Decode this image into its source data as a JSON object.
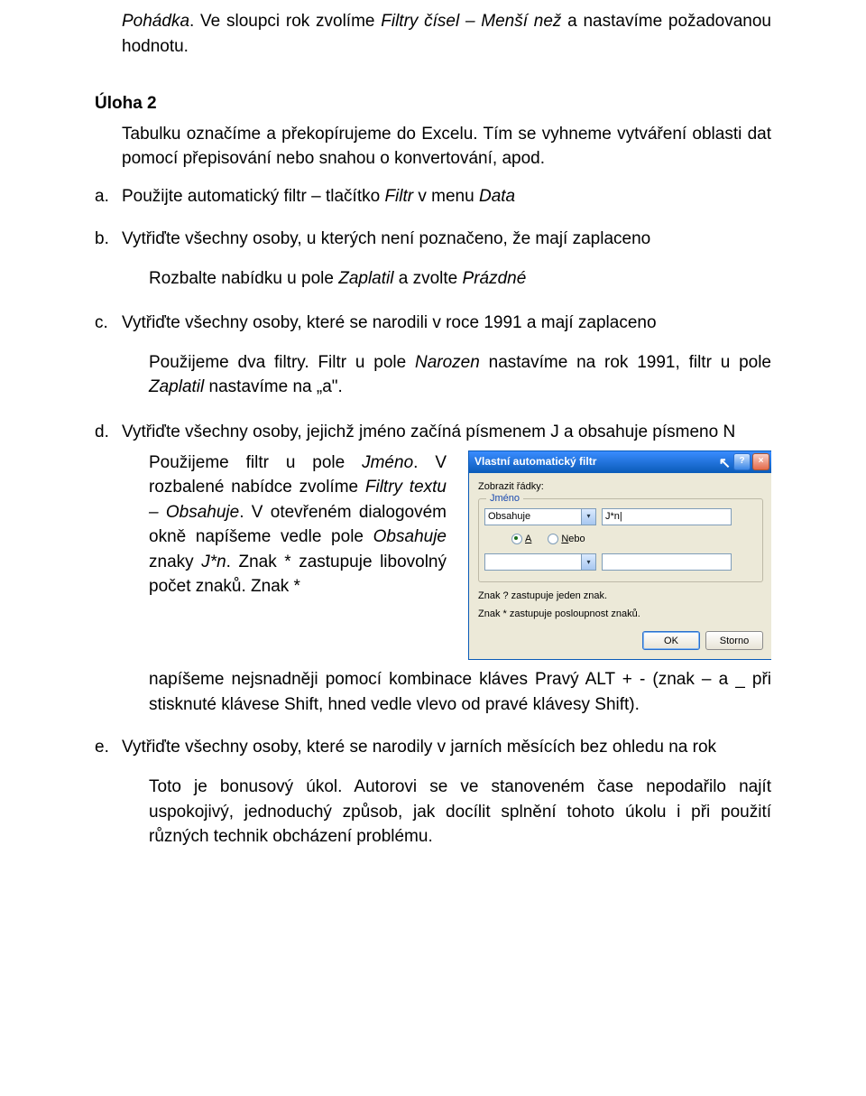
{
  "intro_prefix": "Pohádka",
  "intro_mid1": ".  Ve sloupci rok zvolíme ",
  "intro_italic2": "Filtry čísel – Menší než",
  "intro_tail": " a nastavíme požadovanou hodnotu.",
  "uloha_title": "Úloha 2",
  "uloha_intro_1": "Tabulku  označíme  a překopírujeme  do Excelu.  Tím  se vyhneme  vytváření oblasti dat pomocí přepisování nebo snahou o konvertování, apod.",
  "a_marker": "a.",
  "a_text_pre": "Použijte automatický filtr – tlačítko ",
  "a_italic1": "Filtr",
  "a_mid": " v menu ",
  "a_italic2": "Data",
  "b_marker": "b.",
  "b_text": "Vytřiďte všechny osoby, u kterých není poznačeno, že mají zaplaceno",
  "b_answer_pre": "Rozbalte nabídku u pole ",
  "b_answer_it1": "Zaplatil",
  "b_answer_mid": " a zvolte ",
  "b_answer_it2": "Prázdné",
  "c_marker": "c.",
  "c_text": "Vytřiďte všechny osoby, které se narodili v roce 1991 a mají zaplaceno",
  "c_answer_1": "Použijeme dva filtry. Filtr u pole ",
  "c_answer_it1": "Narozen",
  "c_answer_2": " nastavíme na rok 1991, filtr u pole ",
  "c_answer_it2": "Zaplatil",
  "c_answer_3": " nastavíme na „a\".",
  "d_marker": "d.",
  "d_text": "Vytřiďte všechny osoby, jejichž jméno začíná písmenem J a obsahuje písmeno N",
  "d_left_1": "Použijeme filtr u pole ",
  "d_left_it1": "Jméno",
  "d_left_2": ". V rozbalené nabídce zvolíme ",
  "d_left_it2": "Filtry textu – Obsahuje",
  "d_left_3": ". V otevřeném dialogovém okně napíšeme vedle pole ",
  "d_left_it3": "Obsahuje",
  "d_left_4": " znaky ",
  "d_left_it4": "J*n",
  "d_left_5": ". Znak * zastupuje libovolný počet znaků. Znak *",
  "d_cont": " napíšeme nejsnadněji pomocí kombinace kláves Pravý ALT + - (znak – a _ při stisknuté klávese Shift, hned vedle vlevo od pravé klávesy Shift).",
  "e_marker": "e.",
  "e_text": "Vytřiďte všechny osoby, které se narodily v jarních měsících bez ohledu na rok",
  "e_answer": "Toto je bonusový úkol. Autorovi se ve stanoveném čase nepodařilo najít uspokojivý, jednoduchý způsob, jak docílit splnění tohoto úkolu i při použití různých technik obcházení problému.",
  "dialog": {
    "title": "Vlastní automatický filtr",
    "help": "?",
    "close": "×",
    "lbl_rows": "Zobrazit řádky:",
    "group_label": "Jméno",
    "combo1_value": "Obsahuje",
    "txt1_value": "J*n|",
    "radio_a": "A",
    "radio_nebo": "Nebo",
    "combo2_value": "",
    "txt2_value": "",
    "hint1": "Znak ? zastupuje jeden znak.",
    "hint2": "Znak * zastupuje posloupnost znaků.",
    "btn_ok": "OK",
    "btn_cancel": "Storno"
  }
}
